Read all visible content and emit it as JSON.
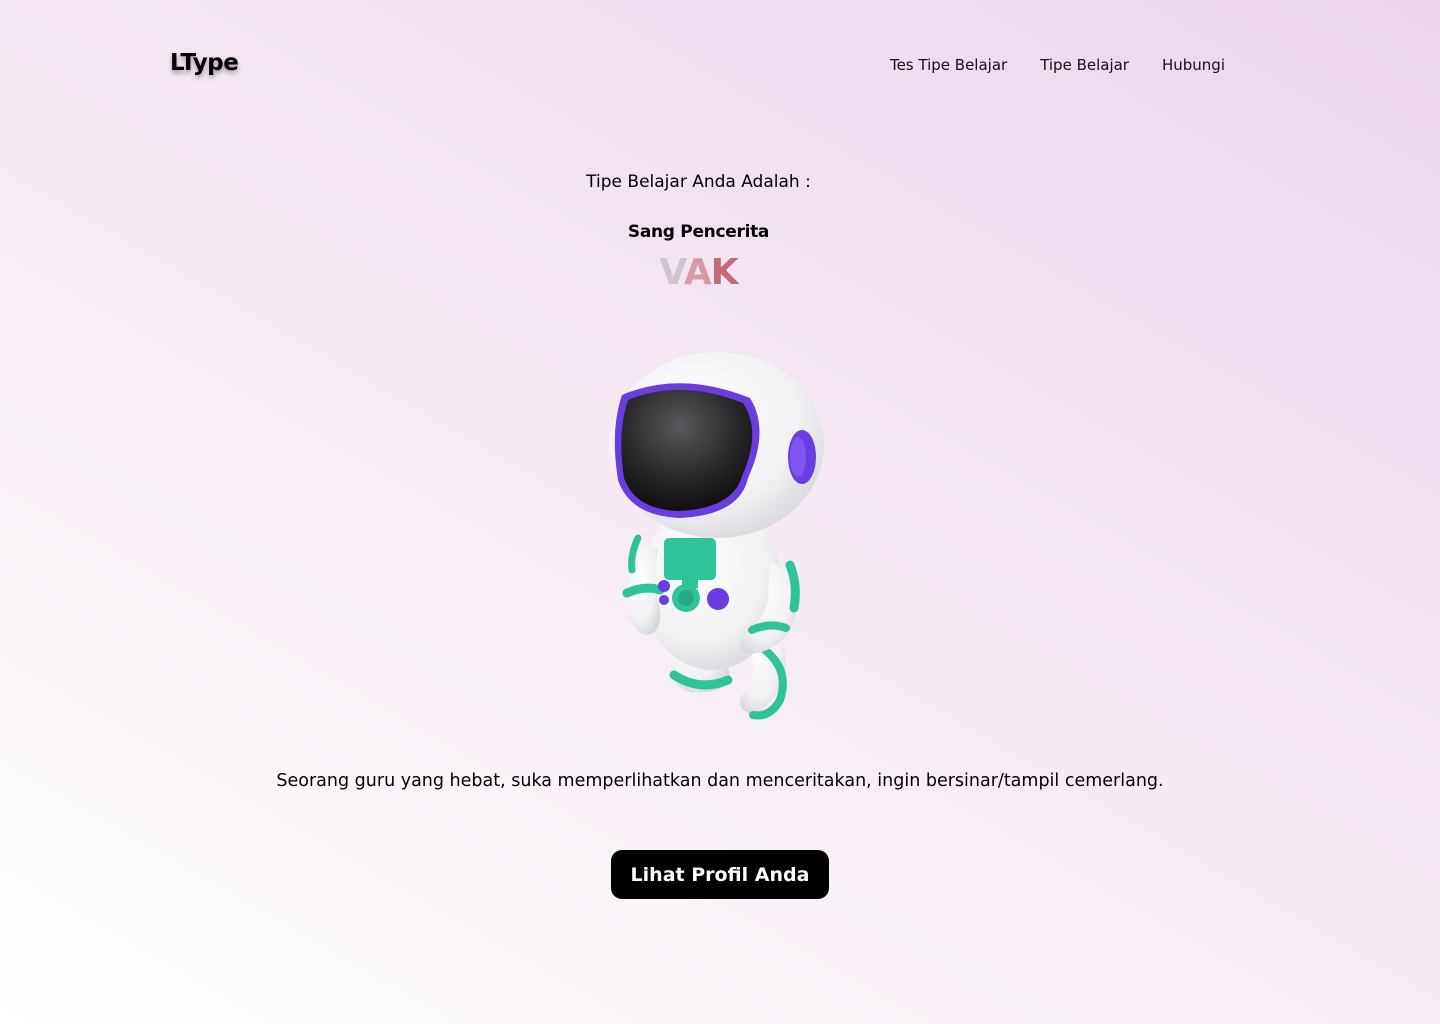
{
  "header": {
    "logo": "LType",
    "nav": [
      "Tes Tipe Belajar",
      "Tipe Belajar",
      "Hubungi"
    ]
  },
  "result": {
    "intro": "Tipe Belajar Anda Adalah :",
    "persona": "Sang Pencerita",
    "code_letters": [
      "V",
      "A",
      "K"
    ],
    "illustration": "astronaut-illustration",
    "description": "Seorang guru yang hebat, suka memperlihatkan dan menceritakan, ingin bersinar/tampil cemerlang.",
    "button_label": "Lihat Profil Anda"
  },
  "colors": {
    "accent_purple": "#6a3de0",
    "accent_teal": "#2fc39a",
    "button_bg": "#000000"
  }
}
